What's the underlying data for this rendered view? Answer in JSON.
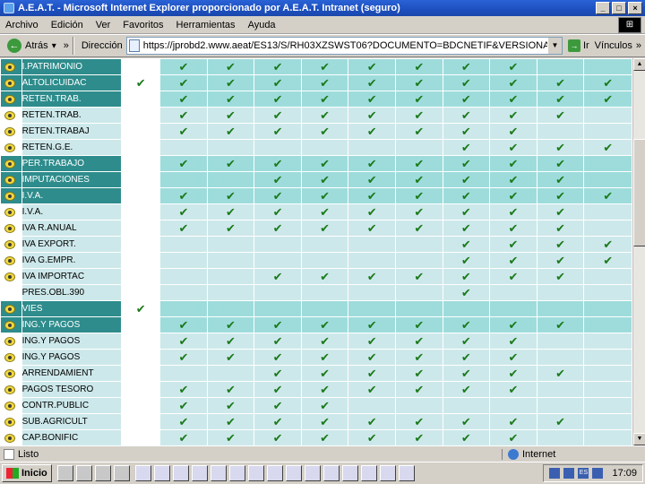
{
  "window": {
    "title": "A.E.A.T. - Microsoft Internet Explorer proporcionado por A.E.A.T. Intranet (seguro)",
    "btn_min": "_",
    "btn_max": "□",
    "btn_close": "×"
  },
  "menu": [
    "Archivo",
    "Edición",
    "Ver",
    "Favoritos",
    "Herramientas",
    "Ayuda"
  ],
  "toolbar": {
    "back_label": "Atrás",
    "address_label": "Dirección",
    "url": "https://jprobd2.www.aeat/ES13/S/RH03XZSWST06?DOCUMENTO=BDCNETIF&VERSIONANT=0C1&T",
    "go_label": "Ir",
    "links_label": "Vínculos",
    "more": "»"
  },
  "check": "✔",
  "rows": [
    {
      "type": "grp",
      "bullet": true,
      "name": "I.PATRIMONIO",
      "c1": false,
      "cells": [
        1,
        1,
        1,
        1,
        1,
        1,
        1,
        1,
        0,
        0
      ]
    },
    {
      "type": "grp",
      "bullet": true,
      "name": "ALTOLICUIDAC",
      "c1": true,
      "cells": [
        1,
        1,
        1,
        1,
        1,
        1,
        1,
        1,
        1,
        1
      ]
    },
    {
      "type": "grp",
      "bullet": true,
      "name": "RETEN.TRAB.",
      "c1": false,
      "cells": [
        1,
        1,
        1,
        1,
        1,
        1,
        1,
        1,
        1,
        1
      ]
    },
    {
      "type": "sub",
      "bullet": true,
      "name": "RETEN.TRAB.",
      "c1": false,
      "cells": [
        1,
        1,
        1,
        1,
        1,
        1,
        1,
        1,
        1,
        0
      ]
    },
    {
      "type": "sub",
      "bullet": true,
      "name": "RETEN.TRABAJ",
      "c1": false,
      "cells": [
        1,
        1,
        1,
        1,
        1,
        1,
        1,
        1,
        0,
        0
      ]
    },
    {
      "type": "sub",
      "bullet": true,
      "name": "RETEN.G.E.",
      "c1": false,
      "cells": [
        0,
        0,
        0,
        0,
        0,
        0,
        1,
        1,
        1,
        1
      ]
    },
    {
      "type": "grp",
      "bullet": true,
      "name": "PER.TRABAJO",
      "c1": false,
      "cells": [
        1,
        1,
        1,
        1,
        1,
        1,
        1,
        1,
        1,
        0
      ]
    },
    {
      "type": "grp",
      "bullet": true,
      "name": "IMPUTACIONES",
      "c1": false,
      "cells": [
        0,
        0,
        1,
        1,
        1,
        1,
        1,
        1,
        1,
        0
      ]
    },
    {
      "type": "grp",
      "bullet": true,
      "name": "I.V.A.",
      "c1": false,
      "cells": [
        1,
        1,
        1,
        1,
        1,
        1,
        1,
        1,
        1,
        1
      ]
    },
    {
      "type": "sub",
      "bullet": true,
      "name": "I.V.A.",
      "c1": false,
      "cells": [
        1,
        1,
        1,
        1,
        1,
        1,
        1,
        1,
        1,
        0
      ]
    },
    {
      "type": "sub",
      "bullet": true,
      "name": "IVA R.ANUAL",
      "c1": false,
      "cells": [
        1,
        1,
        1,
        1,
        1,
        1,
        1,
        1,
        1,
        0
      ]
    },
    {
      "type": "sub",
      "bullet": true,
      "name": "IVA EXPORT.",
      "c1": false,
      "cells": [
        0,
        0,
        0,
        0,
        0,
        0,
        1,
        1,
        1,
        1
      ]
    },
    {
      "type": "sub",
      "bullet": true,
      "name": "IVA G.EMPR.",
      "c1": false,
      "cells": [
        0,
        0,
        0,
        0,
        0,
        0,
        1,
        1,
        1,
        1
      ]
    },
    {
      "type": "sub",
      "bullet": true,
      "name": "IVA IMPORTAC",
      "c1": false,
      "cells": [
        0,
        0,
        1,
        1,
        1,
        1,
        1,
        1,
        1,
        0
      ]
    },
    {
      "type": "sub",
      "bullet": false,
      "name": "PRES.OBL.390",
      "c1": false,
      "cells": [
        0,
        0,
        0,
        0,
        0,
        0,
        1,
        0,
        0,
        0
      ]
    },
    {
      "type": "grp",
      "bullet": true,
      "name": "VIES",
      "c1": true,
      "cells": [
        0,
        0,
        0,
        0,
        0,
        0,
        0,
        0,
        0,
        0
      ]
    },
    {
      "type": "grp",
      "bullet": true,
      "name": "ING.Y PAGOS",
      "c1": false,
      "cells": [
        1,
        1,
        1,
        1,
        1,
        1,
        1,
        1,
        1,
        0
      ]
    },
    {
      "type": "sub",
      "bullet": true,
      "name": "ING.Y PAGOS",
      "c1": false,
      "cells": [
        1,
        1,
        1,
        1,
        1,
        1,
        1,
        1,
        0,
        0
      ]
    },
    {
      "type": "sub",
      "bullet": true,
      "name": "ING.Y PAGOS",
      "c1": false,
      "cells": [
        1,
        1,
        1,
        1,
        1,
        1,
        1,
        1,
        0,
        0
      ]
    },
    {
      "type": "sub",
      "bullet": true,
      "name": "ARRENDAMIENT",
      "c1": false,
      "cells": [
        0,
        0,
        1,
        1,
        1,
        1,
        1,
        1,
        1,
        0
      ]
    },
    {
      "type": "sub",
      "bullet": true,
      "name": "PAGOS TESORO",
      "c1": false,
      "cells": [
        1,
        1,
        1,
        1,
        1,
        1,
        1,
        1,
        0,
        0
      ]
    },
    {
      "type": "sub",
      "bullet": true,
      "name": "CONTR.PUBLIC",
      "c1": false,
      "cells": [
        1,
        1,
        1,
        1,
        0,
        0,
        0,
        0,
        0,
        0
      ]
    },
    {
      "type": "sub",
      "bullet": true,
      "name": "SUB.AGRICULT",
      "c1": false,
      "cells": [
        1,
        1,
        1,
        1,
        1,
        1,
        1,
        1,
        1,
        0
      ]
    },
    {
      "type": "sub",
      "bullet": true,
      "name": "CAP.BONIFIC",
      "c1": false,
      "cells": [
        1,
        1,
        1,
        1,
        1,
        1,
        1,
        1,
        0,
        0
      ]
    }
  ],
  "status": {
    "left": "Listo",
    "zone": "Internet"
  },
  "taskbar": {
    "start": "Inicio",
    "clock": "17:09",
    "lang": "ES"
  }
}
